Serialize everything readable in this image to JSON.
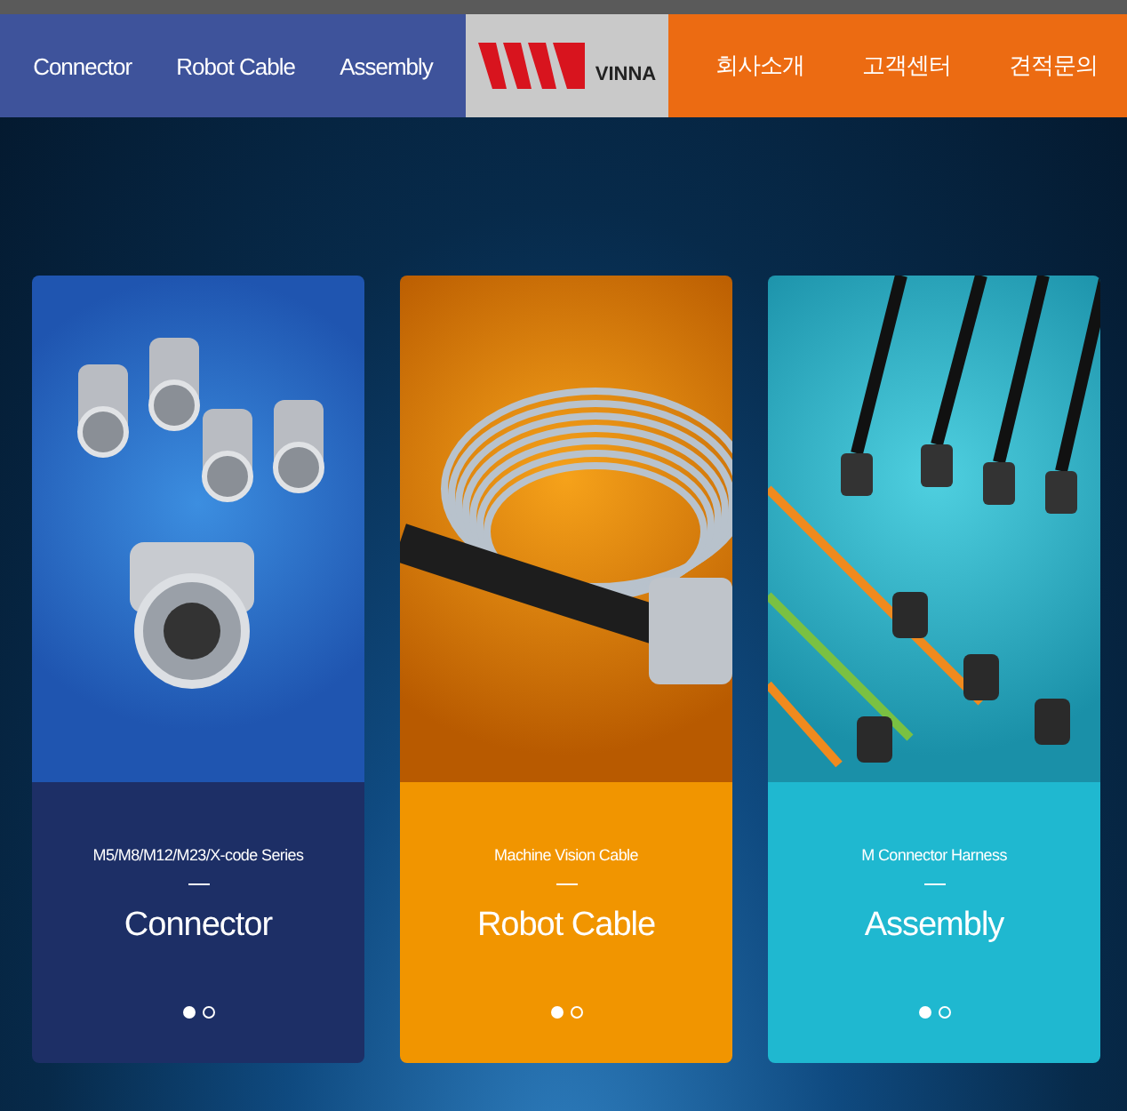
{
  "nav_left": [
    "Connector",
    "Robot Cable",
    "Assembly"
  ],
  "logo": {
    "text": "VINNA"
  },
  "nav_right": [
    "회사소개",
    "고객센터",
    "견적문의"
  ],
  "cards": [
    {
      "kind": "connector",
      "color": "#1d2f66",
      "subtitle": "M5/M8/M12/M23/X-code Series",
      "title": "Connector",
      "dots": [
        {
          "selected": true
        },
        {
          "selected": false
        }
      ]
    },
    {
      "kind": "cable",
      "color": "#f19500",
      "subtitle": "Machine Vision Cable",
      "title": "Robot Cable",
      "dots": [
        {
          "selected": true
        },
        {
          "selected": false
        }
      ]
    },
    {
      "kind": "harness",
      "color": "#1fb8d0",
      "subtitle": "M Connector Harness",
      "title": "Assembly",
      "dots": [
        {
          "selected": true
        },
        {
          "selected": false
        }
      ]
    }
  ]
}
